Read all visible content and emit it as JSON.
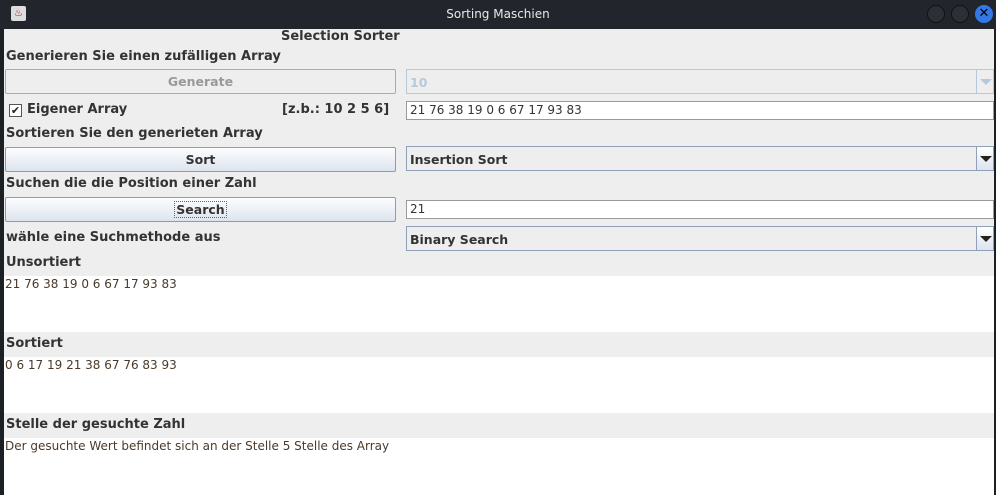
{
  "window": {
    "title": "Sorting Maschien"
  },
  "header": "Selection Sorter",
  "generate": {
    "label": "Generieren Sie einen zufälligen Array",
    "button": "Generate",
    "size_value": "10"
  },
  "custom": {
    "checkbox_label": "Eigener Array",
    "checked": true,
    "hint": "[z.b.: 10 2 5 6]",
    "input_value": "21 76 38 19 0 6 67 17 93 83"
  },
  "sort": {
    "label": "Sortieren Sie den generieten Array",
    "button": "Sort",
    "method": "Insertion Sort"
  },
  "search": {
    "label": "Suchen die die Position einer Zahl",
    "button": "Search",
    "input_value": "21",
    "method_label": "wähle eine Suchmethode aus",
    "method": "Binary Search"
  },
  "results": {
    "unsorted_label": "Unsortiert",
    "unsorted": "21 76 38 19 0 6 67 17 93 83",
    "sorted_label": "Sortiert",
    "sorted": "0 6 17 19 21 38 67 76 83 93",
    "position_label": "Stelle der gesuchte Zahl",
    "position": "Der gesuchte Wert befindet sich an der Stelle 5 Stelle des Array"
  }
}
